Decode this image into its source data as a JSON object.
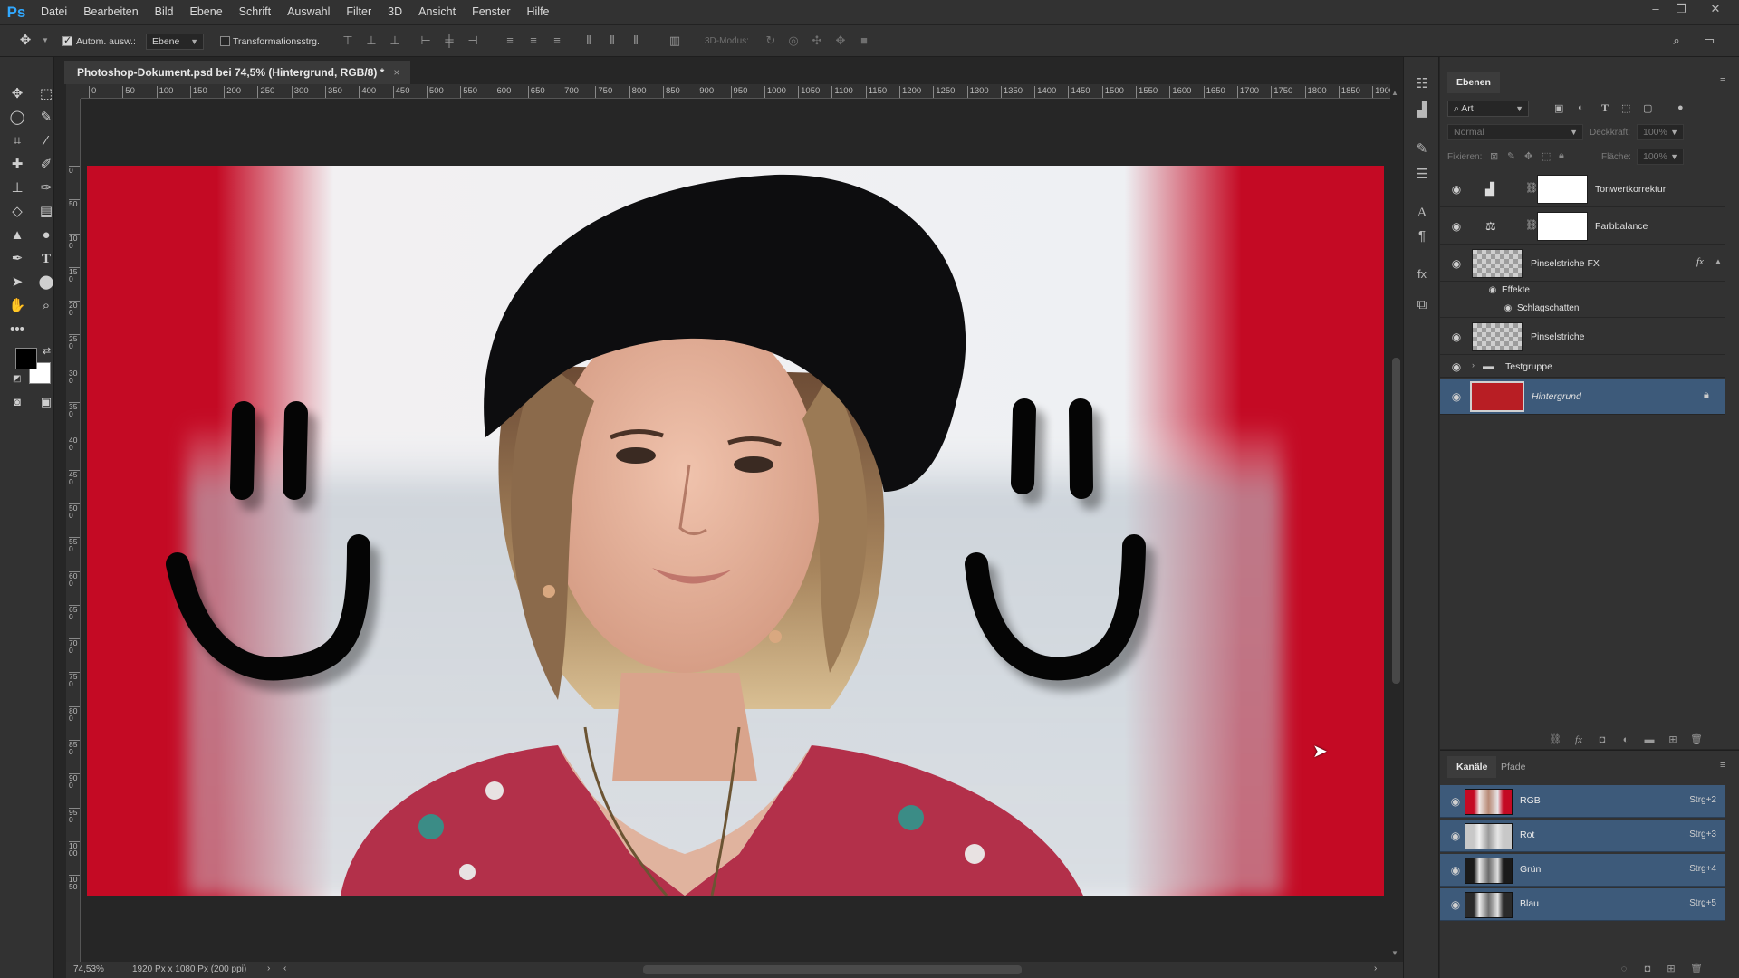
{
  "app": {
    "logo": "Ps",
    "accent": "#31a8ff"
  },
  "menu": [
    "Datei",
    "Bearbeiten",
    "Bild",
    "Ebene",
    "Schrift",
    "Auswahl",
    "Filter",
    "3D",
    "Ansicht",
    "Fenster",
    "Hilfe"
  ],
  "options": {
    "auto_select_label": "Autom. ausw.:",
    "auto_select_checked": true,
    "auto_select_target": "Ebene",
    "transform_label": "Transformationsstrg.",
    "transform_checked": false,
    "mode3d_label": "3D-Modus:"
  },
  "document": {
    "tab_title": "Photoshop-Dokument.psd bei 74,5% (Hintergrund, RGB/8) *",
    "close": "×",
    "zoom": "74,53%",
    "doc_info": "1920 Px x 1080 Px (200 ppi)",
    "ruler_h": [
      "0",
      "50",
      "100",
      "150",
      "200",
      "250",
      "300",
      "350",
      "400",
      "450",
      "500",
      "550",
      "600",
      "650",
      "700",
      "750",
      "800",
      "850",
      "900",
      "950",
      "1000",
      "1050",
      "1100",
      "1150",
      "1200",
      "1250",
      "1300",
      "1350",
      "1400",
      "1450",
      "1500",
      "1550",
      "1600",
      "1650",
      "1700",
      "1750",
      "1800",
      "1850",
      "1900"
    ],
    "ruler_v": [
      "0",
      "50",
      "100",
      "150",
      "200",
      "250",
      "300",
      "350",
      "400",
      "450",
      "500",
      "550",
      "600",
      "650",
      "700",
      "750",
      "800",
      "850",
      "900",
      "950",
      "1000",
      "1050"
    ]
  },
  "layers_panel": {
    "tab": "Ebenen",
    "filter_label": "Art",
    "blend_mode": "Normal",
    "opacity_label": "Deckkraft:",
    "opacity_value": "100%",
    "lock_label": "Fixieren:",
    "fill_label": "Fläche:",
    "fill_value": "100%",
    "layers": [
      {
        "name": "Tonwertkorrektur",
        "kind": "adjustment",
        "icon": "levels-icon"
      },
      {
        "name": "Farbbalance",
        "kind": "adjustment",
        "icon": "color-balance-icon"
      },
      {
        "name": "Pinselstriche FX",
        "kind": "pixel",
        "fx": "fx"
      },
      {
        "name": "Effekte",
        "kind": "effects-header"
      },
      {
        "name": "Schlagschatten",
        "kind": "effect"
      },
      {
        "name": "Pinselstriche",
        "kind": "pixel"
      },
      {
        "name": "Testgruppe",
        "kind": "group"
      },
      {
        "name": "Hintergrund",
        "kind": "background",
        "selected": true,
        "locked": true,
        "color": "#b81e24"
      }
    ]
  },
  "channels_panel": {
    "tabs": [
      "Kanäle",
      "Pfade"
    ],
    "channels": [
      {
        "name": "RGB",
        "shortcut": "Strg+2"
      },
      {
        "name": "Rot",
        "shortcut": "Strg+3"
      },
      {
        "name": "Grün",
        "shortcut": "Strg+4"
      },
      {
        "name": "Blau",
        "shortcut": "Strg+5"
      }
    ]
  },
  "colors": {
    "foreground": "#000000",
    "background": "#ffffff",
    "canvas_red": "#c40a24",
    "selection": "#3d5a7a"
  }
}
